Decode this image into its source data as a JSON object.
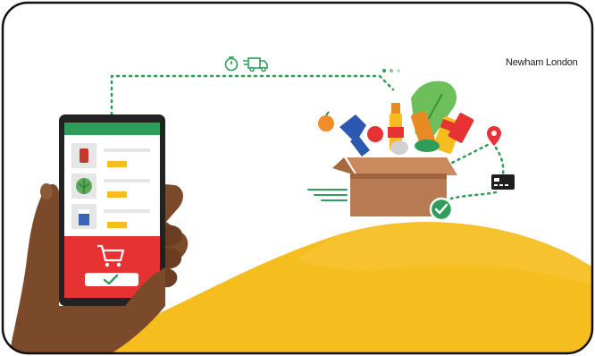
{
  "brand": {
    "logo_text": "Newham London"
  },
  "colors": {
    "frame": "#111111",
    "hill": "#f5bd1e",
    "accent_green": "#2e9d5a",
    "phone_red": "#e63232",
    "skin": "#7a4a2b",
    "box": "#b77a52"
  },
  "icons": [
    "stopwatch-icon",
    "delivery-truck-icon",
    "shopping-cart-icon",
    "checkmark-icon",
    "location-pin-icon",
    "credit-card-icon"
  ]
}
